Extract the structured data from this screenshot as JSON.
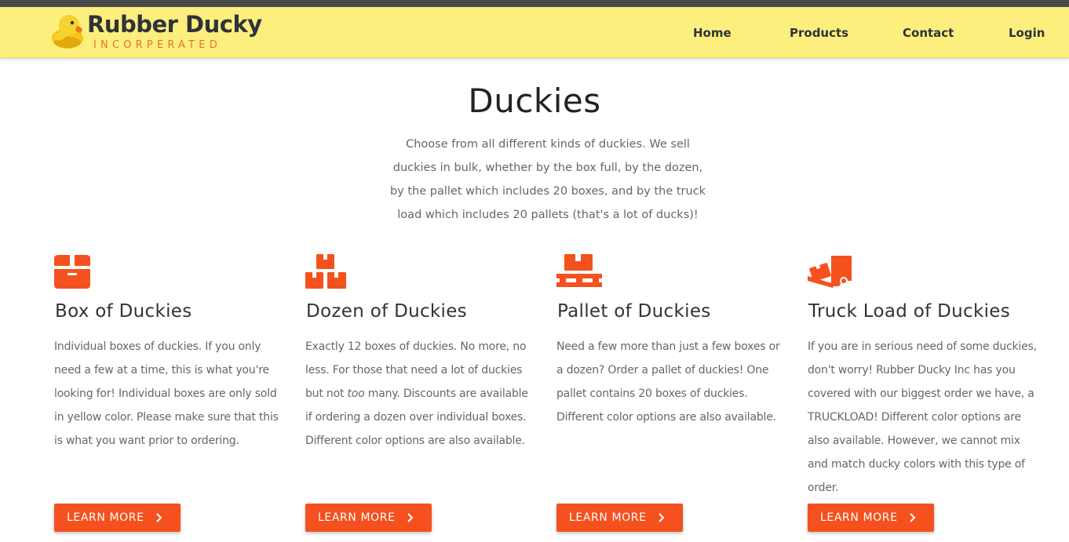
{
  "brand": {
    "name": "Rubber Ducky",
    "subtitle": "INCORPERATED"
  },
  "nav": {
    "items": [
      {
        "label": "Home"
      },
      {
        "label": "Products"
      },
      {
        "label": "Contact"
      },
      {
        "label": "Login"
      }
    ]
  },
  "page": {
    "title": "Duckies",
    "intro": "Choose from all different kinds of duckies. We sell duckies in bulk, whether by the box full, by the dozen, by the pallet which includes 20 boxes, and by the truck load which includes 20 pallets (that's a lot of ducks)!"
  },
  "cards": [
    {
      "icon": "box-icon",
      "title": "Box of Duckies",
      "text": "Individual boxes of duckies. If you only need a few at a time, this is what you're looking for! Individual boxes are only sold in yellow color. Please make sure that this is what you want prior to ordering.",
      "button": "LEARN MORE"
    },
    {
      "icon": "boxes-icon",
      "title": "Dozen of Duckies",
      "text_before": "Exactly 12 boxes of duckies. No more, no less. For those that need a lot of duckies but not ",
      "text_em": "too",
      "text_after": " many. Discounts are available if ordering a dozen over individual boxes. Different color options are also available.",
      "button": "LEARN MORE"
    },
    {
      "icon": "pallet-icon",
      "title": "Pallet of Duckies",
      "text": "Need a few more than just a few boxes or a dozen? Order a pallet of duckies! One pallet contains 20 boxes of duckies. Different color options are also available.",
      "button": "LEARN MORE"
    },
    {
      "icon": "dolly-icon",
      "title": "Truck Load of Duckies",
      "text": "If you are in serious need of some duckies, don't worry! Rubber Ducky Inc has you covered with our biggest order we have, a TRUCKLOAD! Different color options are also available. However, we cannot mix and match ducky colors with this type of order.",
      "button": "LEARN MORE"
    }
  ],
  "colors": {
    "navbar": "#fcef7e",
    "accent": "#f4511e",
    "brand_sub": "#e8732a",
    "text_dark": "#2f3338"
  }
}
